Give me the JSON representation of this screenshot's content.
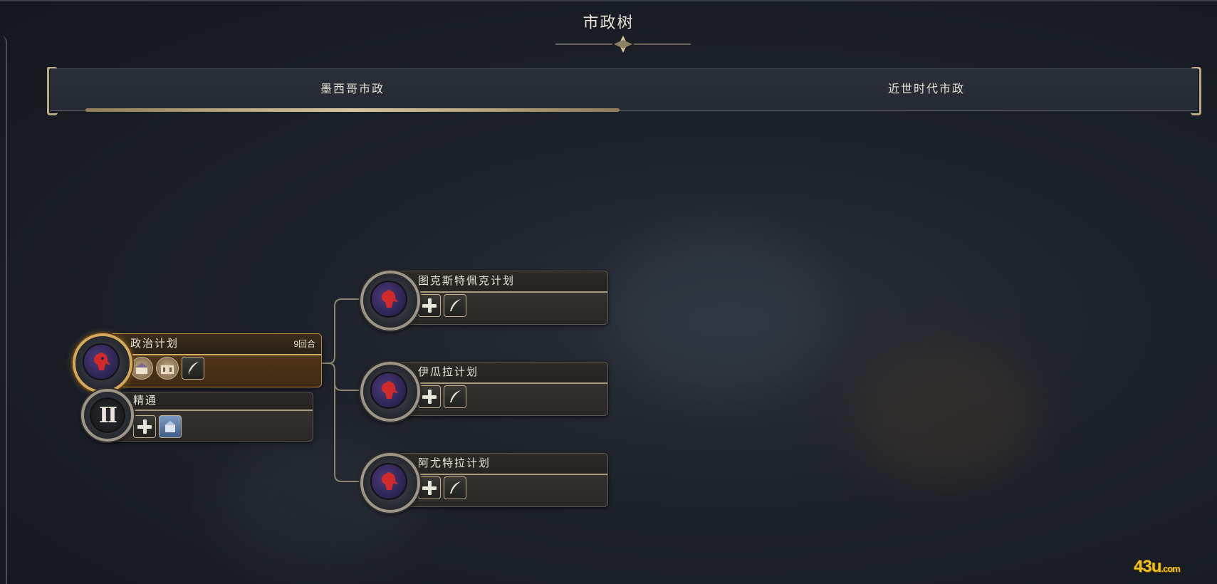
{
  "screen": {
    "title": "市政树"
  },
  "tabs": [
    {
      "label": "墨西哥市政",
      "active": true
    },
    {
      "label": "近世时代市政",
      "active": false
    }
  ],
  "nodes": {
    "political_plan": {
      "name": "政治计划",
      "turns": "9回合",
      "state": "in-progress",
      "icons": [
        "palace-portrait-icon",
        "building-portrait-icon",
        "quill-icon"
      ]
    },
    "mastery": {
      "name": "精通",
      "numeral": "II",
      "icons": [
        "plus-icon",
        "building-icon"
      ]
    },
    "tuxtepec_plan": {
      "name": "图克斯特佩克计划",
      "icons": [
        "plus-icon",
        "quill-icon"
      ]
    },
    "iguala_plan": {
      "name": "伊瓜拉计划",
      "icons": [
        "plus-icon",
        "quill-icon"
      ]
    },
    "ayutla_plan": {
      "name": "阿尤特拉计划",
      "icons": [
        "plus-icon",
        "quill-icon"
      ]
    }
  },
  "watermark": {
    "main": "43u",
    "suffix": ".com"
  },
  "colors": {
    "accent_gold": "#d4a95c",
    "tab_underline": "#d8c8a0",
    "watermark": "#f2c41a"
  }
}
